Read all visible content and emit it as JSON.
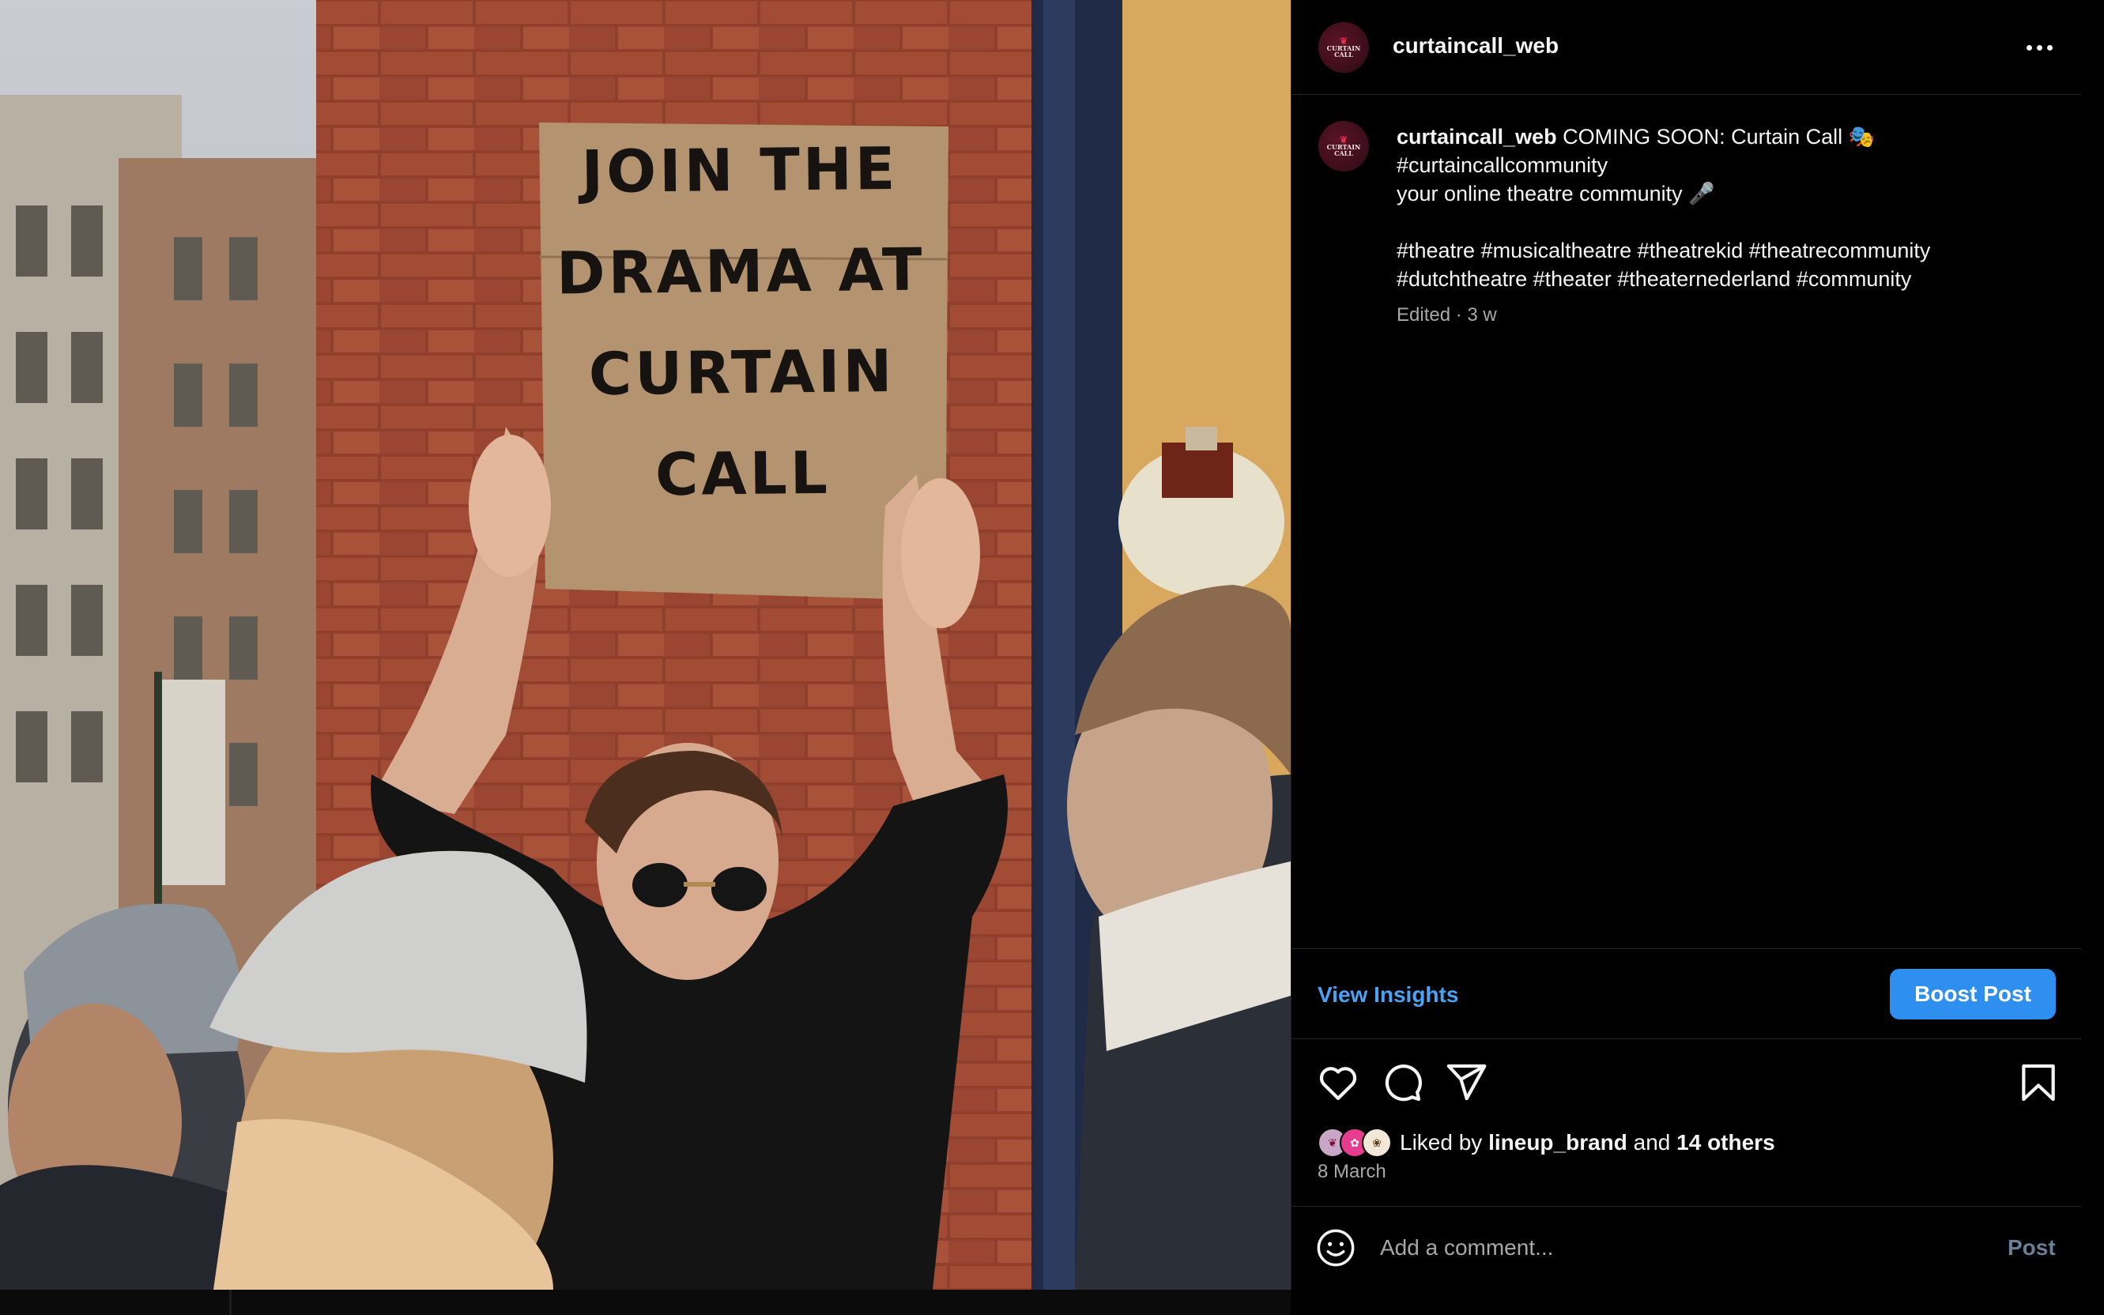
{
  "post": {
    "username": "curtaincall_web",
    "avatar_text": "CURTAIN CALL",
    "caption_lines": [
      "COMING SOON: Curtain Call 🎭",
      "#curtaincallcommunity",
      "your online theatre community 🎤",
      "",
      "#theatre #musicaltheatre #theatrekid #theatrecommunity",
      "#dutchtheatre #theater #theaternederland #community"
    ],
    "edited_meta": "Edited · 3 w",
    "photo_sign_lines": [
      "JOIN THE",
      "DRAMA AT",
      "CURTAIN",
      "CALL"
    ]
  },
  "insights": {
    "view_label": "View Insights",
    "boost_label": "Boost Post"
  },
  "likes": {
    "prefix": "Liked by",
    "user": "lineup_brand",
    "conjunction": "and",
    "others": "14 others",
    "date": "8 March"
  },
  "comment": {
    "placeholder": "Add a comment...",
    "post_label": "Post"
  },
  "colors": {
    "accent_link": "#4aa3f5",
    "boost_button": "#2f8ff0",
    "background": "#000000",
    "divider": "#262626",
    "muted_text": "#a8a8a8"
  },
  "icons": [
    "more-icon",
    "heart-icon",
    "comment-icon",
    "share-icon",
    "bookmark-icon",
    "emoji-icon"
  ]
}
